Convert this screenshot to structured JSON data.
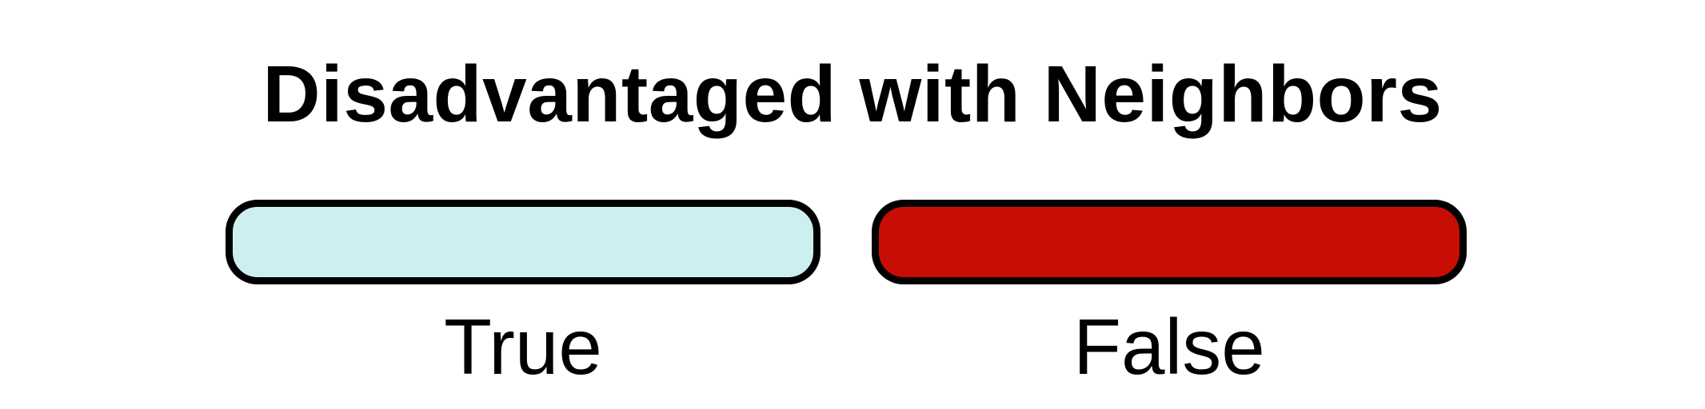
{
  "legend": {
    "title": "Disadvantaged with Neighbors",
    "items": [
      {
        "label": "True",
        "color": "#cdeff0"
      },
      {
        "label": "False",
        "color": "#c80d04"
      }
    ]
  }
}
